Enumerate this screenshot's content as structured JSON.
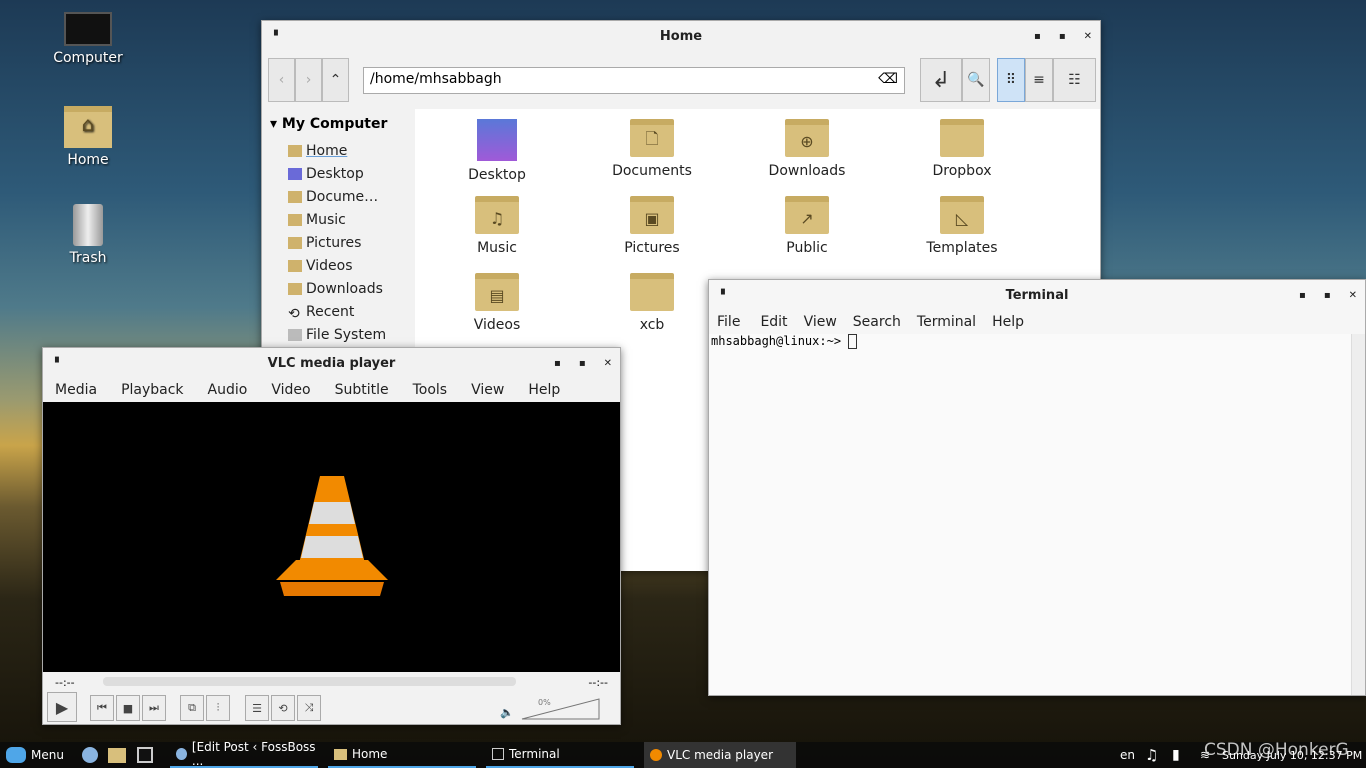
{
  "desktop": {
    "icons": [
      {
        "label": "Computer",
        "icon": "monitor-icon"
      },
      {
        "label": "Home",
        "icon": "home-folder-icon"
      },
      {
        "label": "Trash",
        "icon": "trash-icon"
      }
    ]
  },
  "file_manager": {
    "title": "Home",
    "path": "/home/mhsabbagh",
    "sidebar": {
      "header": "My Computer",
      "items": [
        "Home",
        "Desktop",
        "Docume…",
        "Music",
        "Pictures",
        "Videos",
        "Downloads",
        "Recent",
        "File System"
      ]
    },
    "items": [
      {
        "label": "Desktop",
        "glyph": ""
      },
      {
        "label": "Documents",
        "glyph": "🗋"
      },
      {
        "label": "Downloads",
        "glyph": "⊕"
      },
      {
        "label": "Dropbox",
        "glyph": ""
      },
      {
        "label": "Music",
        "glyph": "♫"
      },
      {
        "label": "Pictures",
        "glyph": "▣"
      },
      {
        "label": "Public",
        "glyph": "↗"
      },
      {
        "label": "Templates",
        "glyph": "◺"
      },
      {
        "label": "Videos",
        "glyph": "▤"
      },
      {
        "label": "xcb",
        "glyph": ""
      }
    ]
  },
  "terminal": {
    "title": "Terminal",
    "menu": [
      "File",
      "Edit",
      "View",
      "Search",
      "Terminal",
      "Help"
    ],
    "prompt": "mhsabbagh@linux:~> "
  },
  "vlc": {
    "title": "VLC media player",
    "menu": [
      "Media",
      "Playback",
      "Audio",
      "Video",
      "Subtitle",
      "Tools",
      "View",
      "Help"
    ],
    "elapsed": "--:--",
    "remaining": "--:--",
    "volume": "0%",
    "volume_value": 0
  },
  "taskbar": {
    "menu_label": "Menu",
    "tasks": [
      "[Edit Post ‹ FossBoss ...",
      "Home",
      "Terminal",
      "VLC media player"
    ],
    "active_task": "VLC media player",
    "lang": "en",
    "clock": "Sunday July 10, 12:37 PM"
  },
  "watermark": "CSDN @HonkerG",
  "colors": {
    "accent": "#6a9fd8",
    "folder": "#d8bf7c",
    "vlc_orange": "#f28a00"
  }
}
